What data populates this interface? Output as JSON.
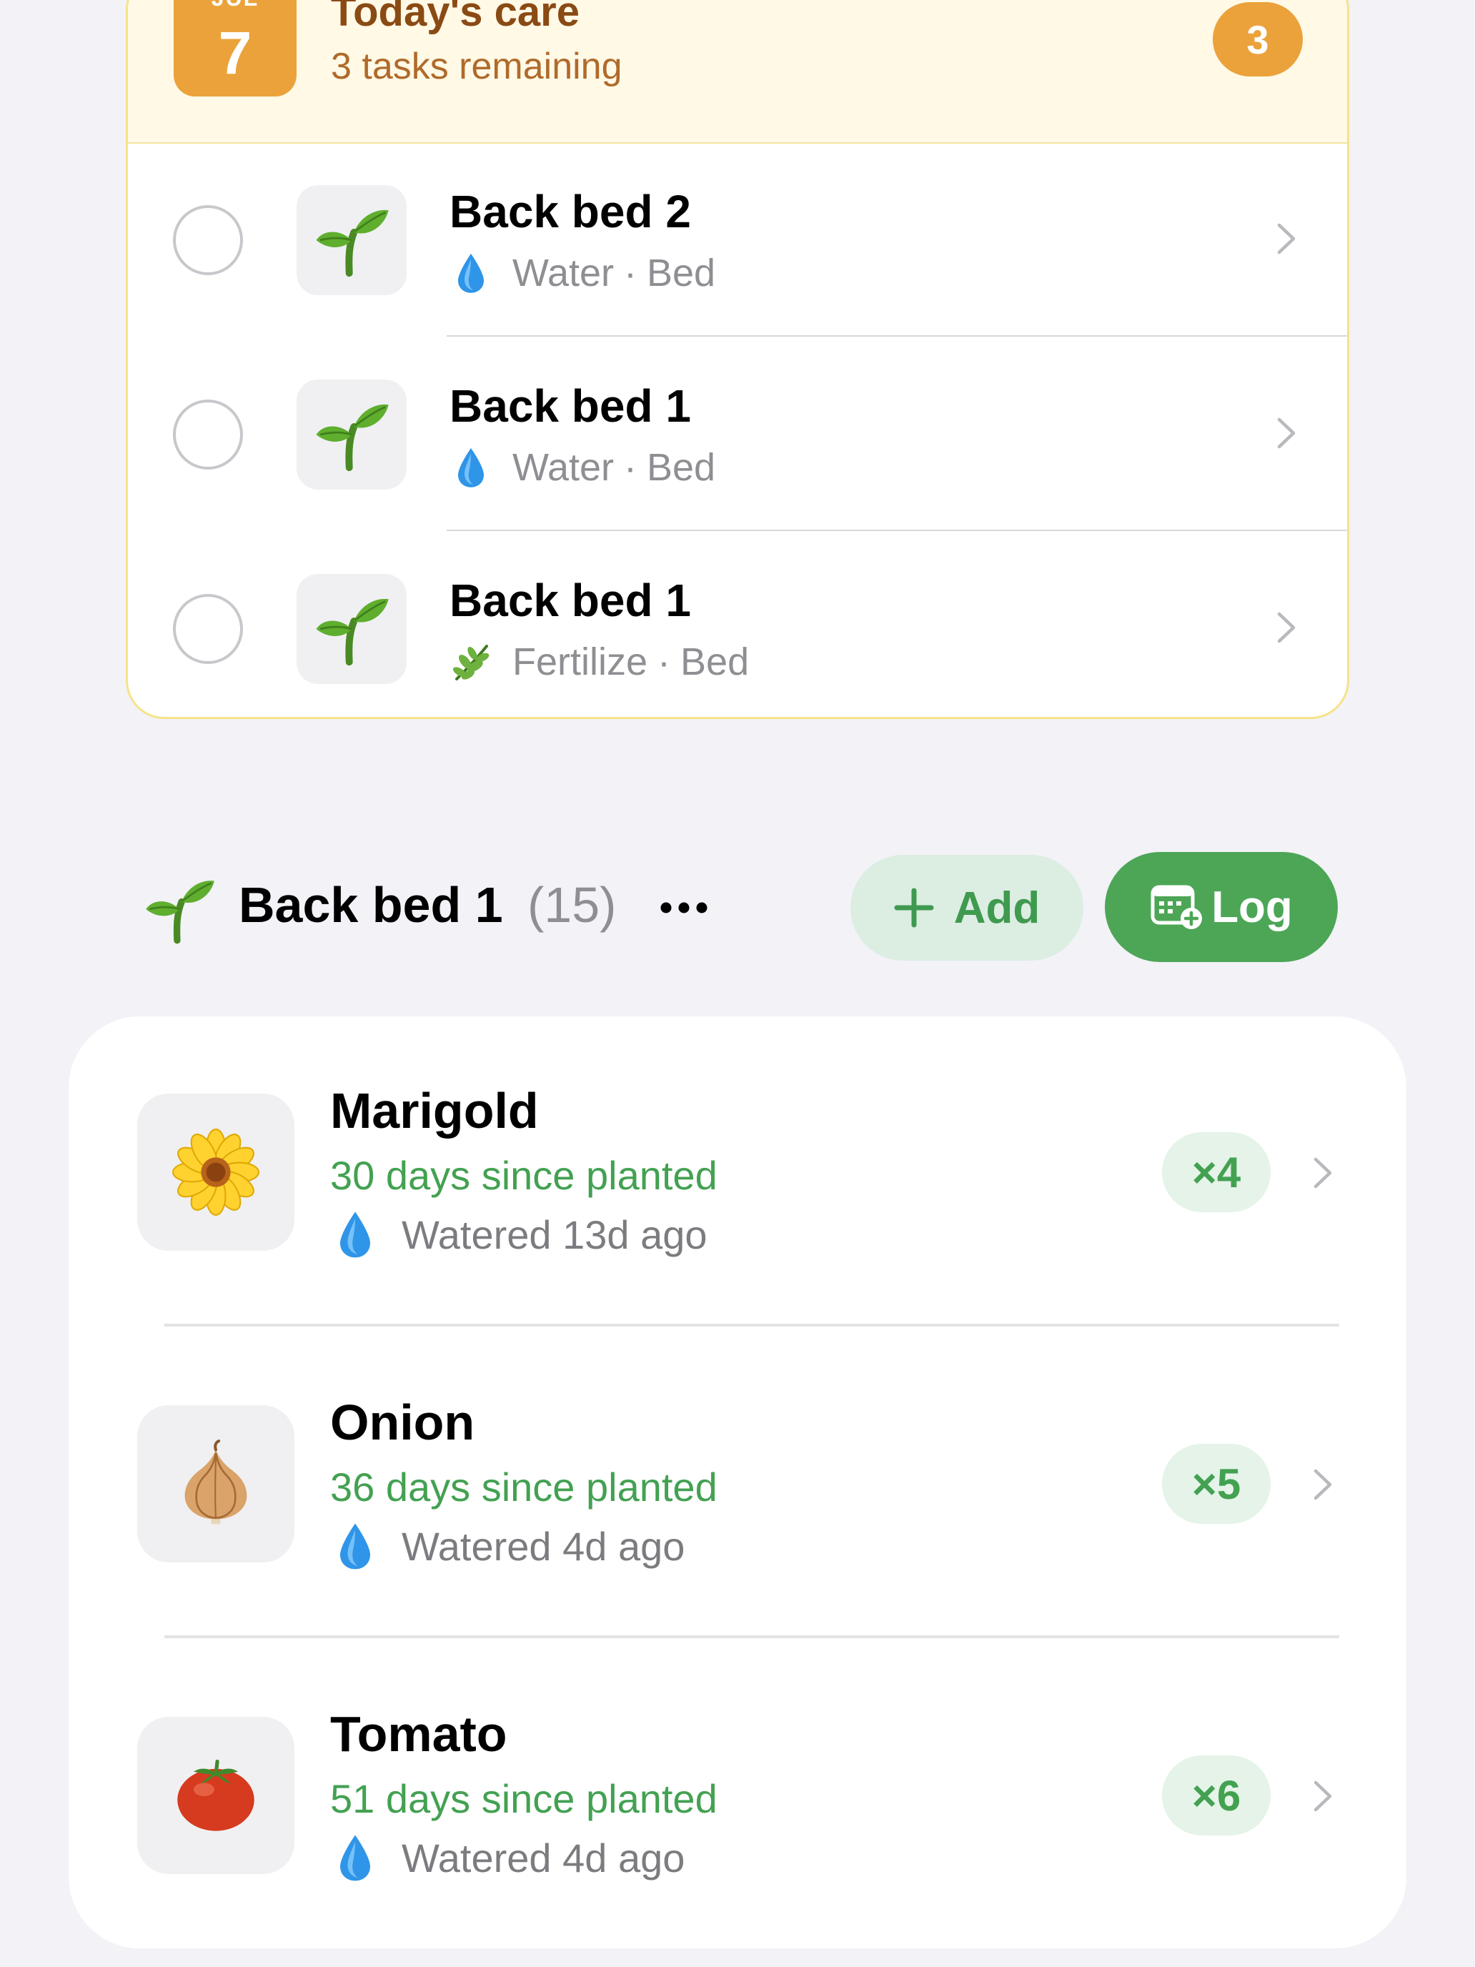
{
  "todays_care": {
    "date_month": "JUL",
    "date_day": "7",
    "title": "Today's care",
    "subtitle": "3 tasks remaining",
    "count": "3",
    "tasks": [
      {
        "name": "Back bed 2",
        "action": "Water",
        "sep": "·",
        "type": "Bed",
        "icon": "water-drop-icon"
      },
      {
        "name": "Back bed 1",
        "action": "Water",
        "sep": "·",
        "type": "Bed",
        "icon": "water-drop-icon"
      },
      {
        "name": "Back bed 1",
        "action": "Fertilize",
        "sep": "·",
        "type": "Bed",
        "icon": "herb-icon"
      }
    ]
  },
  "bed_section": {
    "title": "Back bed 1",
    "count": "(15)",
    "add_label": "Add",
    "log_label": "Log",
    "plants": [
      {
        "name": "Marigold",
        "age": "30 days since planted",
        "watered": "Watered 13d ago",
        "qty": "×4",
        "icon": "sunflower-icon"
      },
      {
        "name": "Onion",
        "age": "36 days since planted",
        "watered": "Watered 4d ago",
        "qty": "×5",
        "icon": "onion-icon"
      },
      {
        "name": "Tomato",
        "age": "51 days since planted",
        "watered": "Watered 4d ago",
        "qty": "×6",
        "icon": "tomato-icon"
      }
    ]
  },
  "colors": {
    "accent_orange": "#eba23b",
    "accent_green": "#4ca656",
    "text_green": "#43a152",
    "background": "#f2f2f7"
  }
}
